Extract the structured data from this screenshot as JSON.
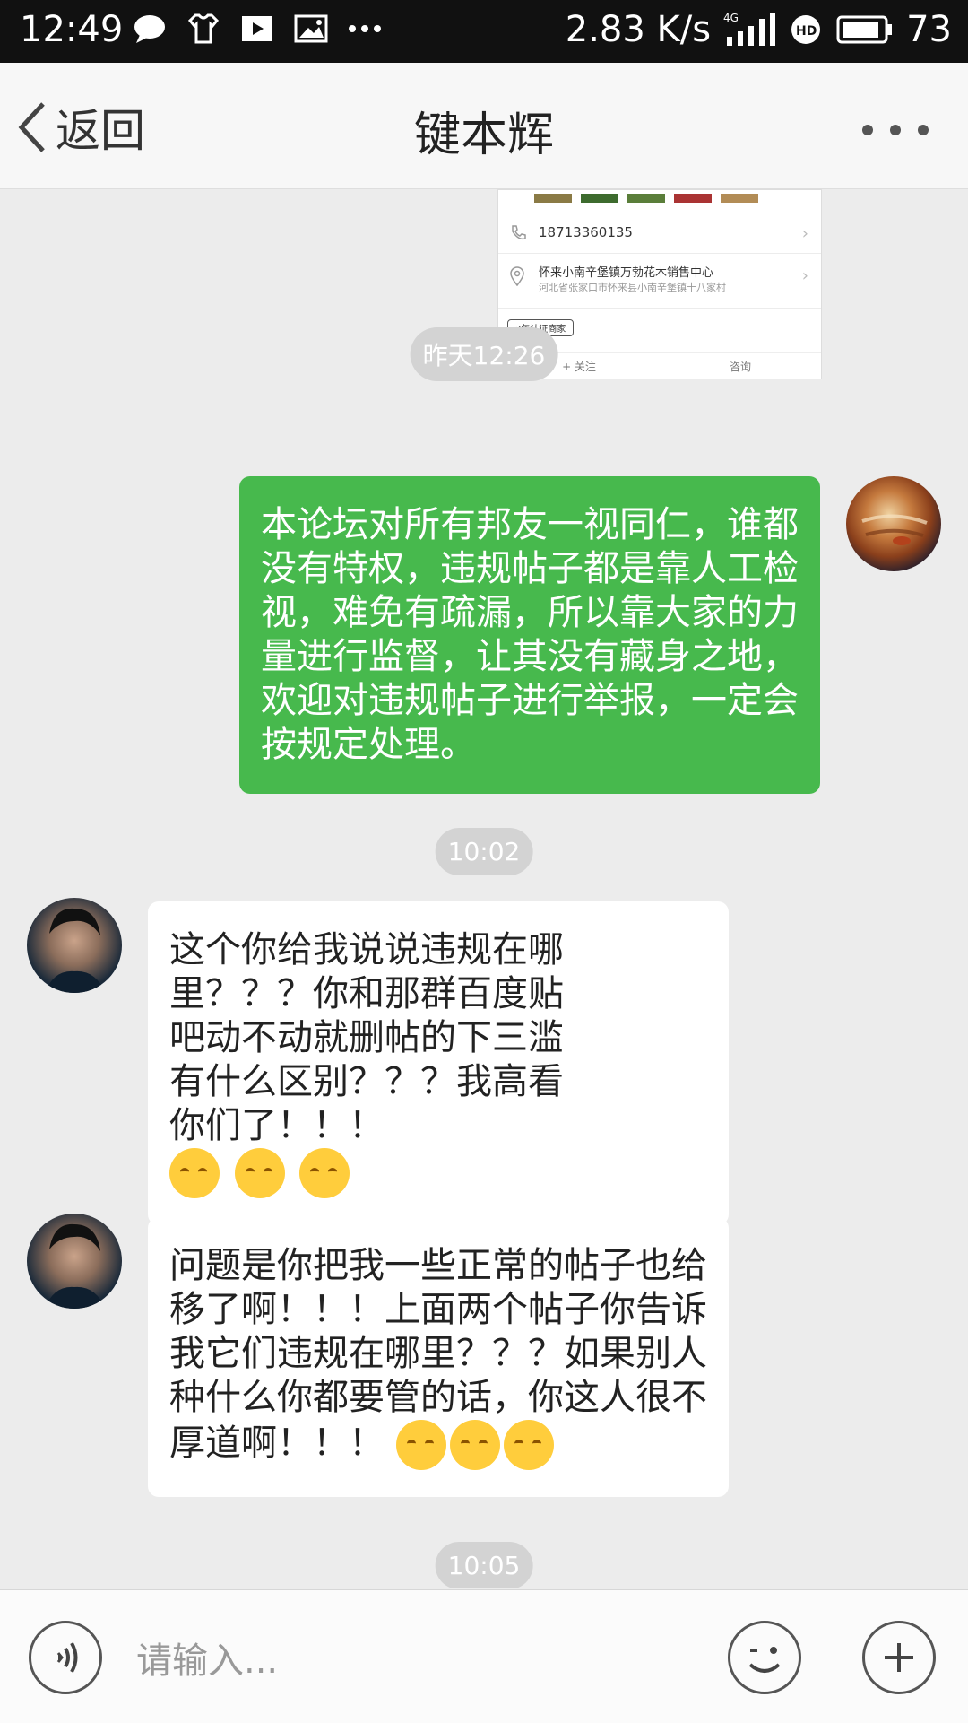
{
  "status_bar": {
    "time": "12:49",
    "network_speed": "2.83 K/s",
    "signal": "4G",
    "battery": "73"
  },
  "header": {
    "back_label": "返回",
    "title": "键本辉"
  },
  "shared_card": {
    "phone": "18713360135",
    "address_line1": "怀来小南辛堡镇万勃花木销售中心",
    "address_line2": "河北省张家口市怀来县小南辛堡镇十八家村",
    "badge": "3年认证商家",
    "follow_label": "+ 关注",
    "consult_label": "咨询"
  },
  "messages": [
    {
      "type": "time",
      "text": "昨天12:26"
    },
    {
      "type": "outgoing",
      "text": "本论坛对所有邦友一视同仁，谁都没有特权，违规帖子都是靠人工检视，难免有疏漏，所以靠大家的力量进行监督，让其没有藏身之地，欢迎对违规帖子进行举报，一定会按规定处理。"
    },
    {
      "type": "time",
      "text": "10:02"
    },
    {
      "type": "incoming",
      "text": "这个你给我说说违规在哪里？？？你和那群百度贴吧动不动就删帖的下三滥有什么区别？？？我高看你们了！！！"
    },
    {
      "type": "incoming",
      "text": "问题是你把我一些正常的帖子也给移了啊！！！上面两个帖子你告诉我它们违规在哪里？？？如果别人种什么你都要管的话，你这人很不厚道啊！！！"
    },
    {
      "type": "time",
      "text": "10:05"
    }
  ],
  "input": {
    "placeholder": "请输入..."
  },
  "colors": {
    "outgoing_bubble": "#47b94d",
    "incoming_bubble": "#ffffff",
    "background": "#ececec"
  }
}
